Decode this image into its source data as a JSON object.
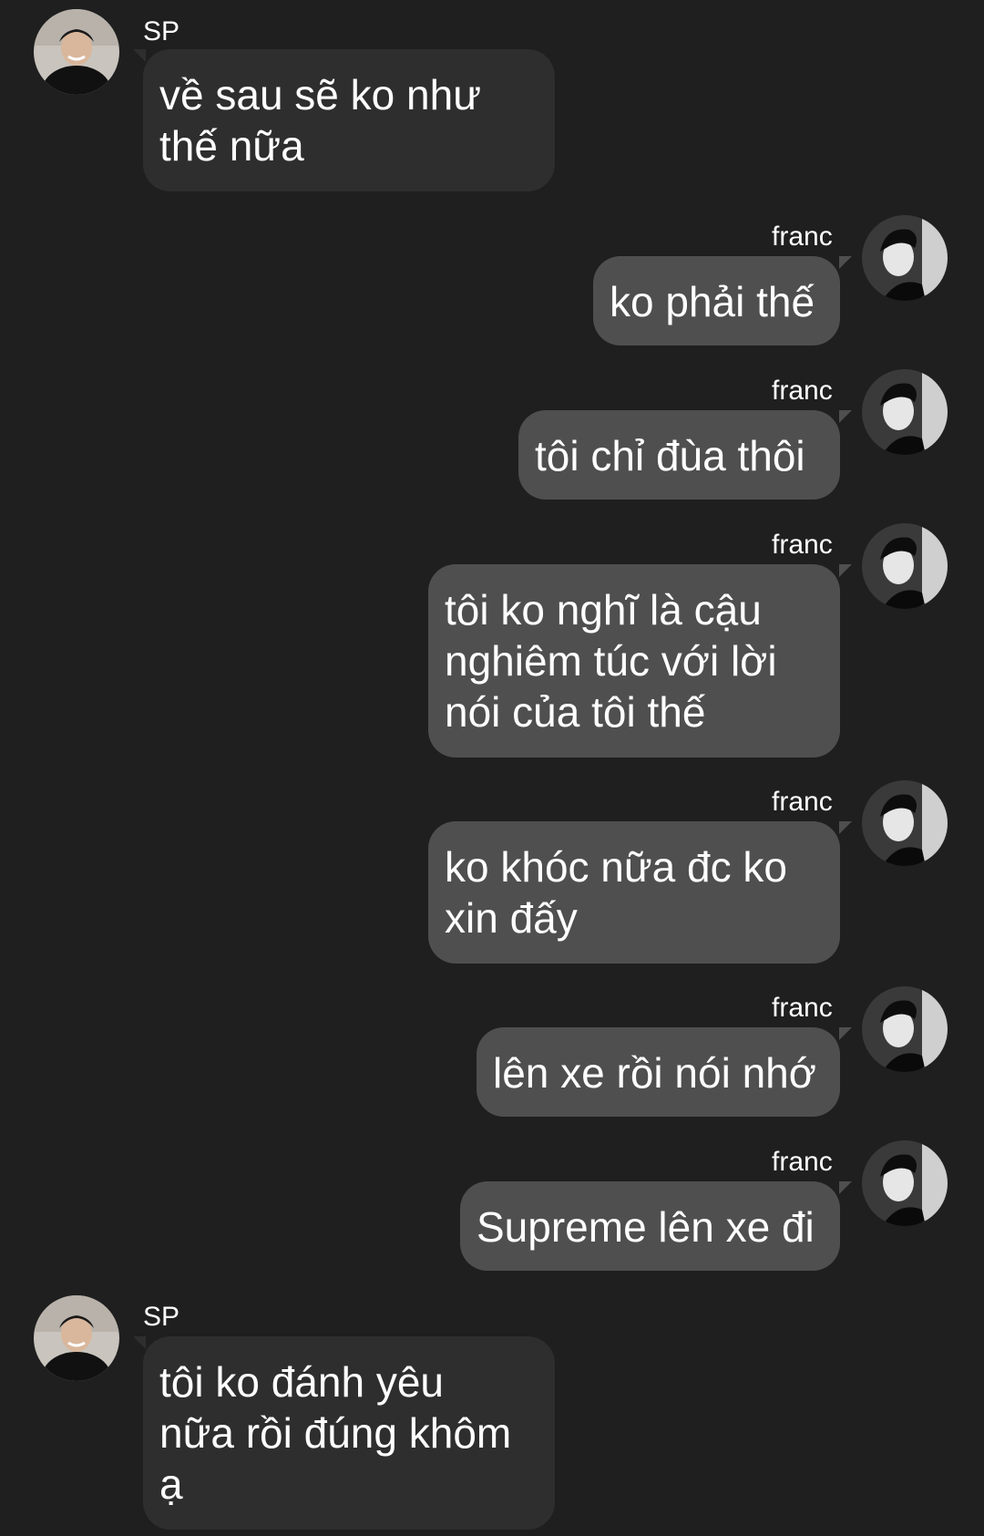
{
  "messages": [
    {
      "sender": "SP",
      "text": "về sau sẽ ko như\nthế nữa"
    },
    {
      "sender": "franc",
      "text": "ko phải thế"
    },
    {
      "sender": "franc",
      "text": "tôi chỉ đùa thôi"
    },
    {
      "sender": "franc",
      "text": "tôi ko nghĩ là cậu\nnghiêm túc với lời\nnói của tôi thế"
    },
    {
      "sender": "franc",
      "text": "ko khóc nữa đc ko\nxin đấy"
    },
    {
      "sender": "franc",
      "text": "lên xe rồi nói nhớ"
    },
    {
      "sender": "franc",
      "text": "Supreme lên xe đi"
    },
    {
      "sender": "SP",
      "text": "tôi ko đánh yêu\nnữa rồi đúng khôm\nạ"
    }
  ],
  "colors": {
    "background": "#1f1f1f",
    "incoming_bubble": "#2e2e2e",
    "outgoing_bubble": "#4f4f4f",
    "text": "#ffffff"
  },
  "icons": {
    "sp_avatar": "sp-avatar-photo",
    "franc_avatar": "franc-avatar-photo"
  }
}
